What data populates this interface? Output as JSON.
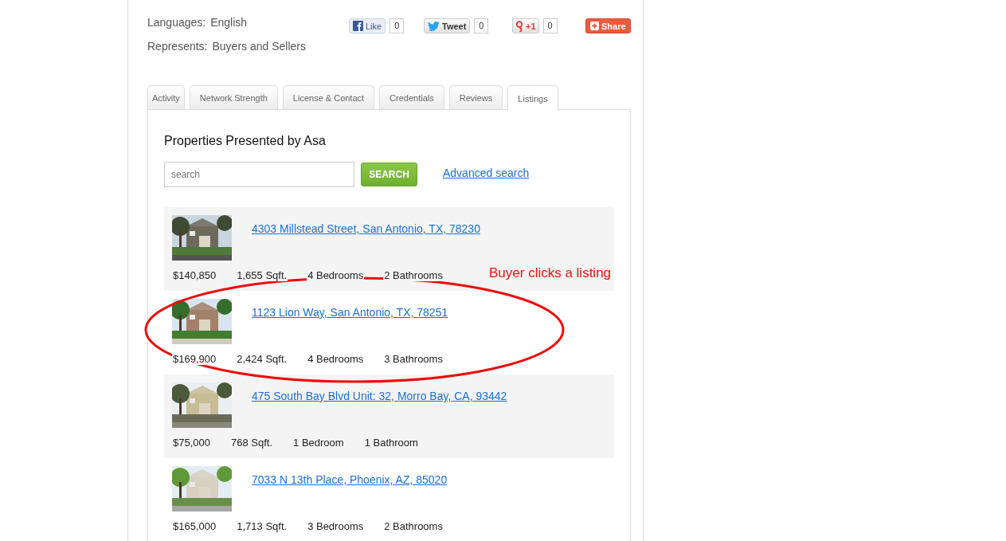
{
  "profile": {
    "languages": {
      "label": "Languages:",
      "value": "English"
    },
    "represents": {
      "label": "Represents:",
      "value": "Buyers and Sellers"
    }
  },
  "social": [
    {
      "kind": "facebook",
      "label": "Like",
      "count": "0"
    },
    {
      "kind": "twitter",
      "label": "Tweet",
      "count": "0"
    },
    {
      "kind": "gplus",
      "label": "+1",
      "count": "0"
    },
    {
      "kind": "share",
      "label": "Share"
    }
  ],
  "tabs": [
    {
      "label": "Activity",
      "selected": false
    },
    {
      "label": "Network Strength",
      "selected": false
    },
    {
      "label": "License & Contact",
      "selected": false
    },
    {
      "label": "Credentials",
      "selected": false
    },
    {
      "label": "Reviews",
      "selected": false
    },
    {
      "label": "Listings",
      "selected": true
    }
  ],
  "listings": {
    "title": "Properties Presented by Asa",
    "search": {
      "placeholder": "search",
      "button": "SEARCH"
    },
    "advanced_link": "Advanced search",
    "items": [
      {
        "address": "4303 Millstead Street, San Antonio, TX, 78230",
        "price": "$140,850",
        "sqft": "1,655 Sqft.",
        "bedrooms": "4 Bedrooms",
        "bathrooms": "2 Bathrooms"
      },
      {
        "address": "1123 Lion Way, San Antonio, TX, 78251",
        "price": "$169,900",
        "sqft": "2,424 Sqft.",
        "bedrooms": "4 Bedrooms",
        "bathrooms": "3 Bathrooms"
      },
      {
        "address": "475 South Bay Blvd Unit: 32, Morro Bay, CA, 93442",
        "price": "$75,000",
        "sqft": "768 Sqft.",
        "bedrooms": "1 Bedroom",
        "bathrooms": "1 Bathroom"
      },
      {
        "address": "7033 N 13th Place, Phoenix, AZ, 85020",
        "price": "$165,000",
        "sqft": "1,713 Sqft.",
        "bedrooms": "3 Bedrooms",
        "bathrooms": "2 Bathrooms"
      }
    ]
  },
  "annotation": {
    "text": "Buyer clicks a listing"
  }
}
